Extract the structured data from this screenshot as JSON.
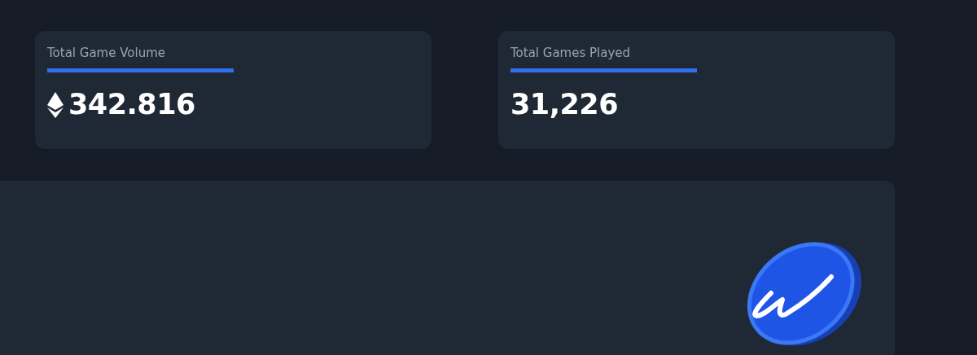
{
  "stats": [
    {
      "label": "Total Game Volume",
      "value": "342.816",
      "kind": "eth"
    },
    {
      "label": "Total Games Played",
      "value": "31,226",
      "kind": "count"
    }
  ]
}
